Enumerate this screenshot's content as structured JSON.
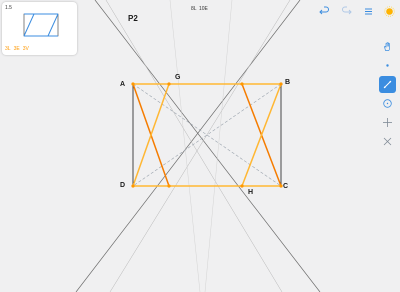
{
  "level": {
    "name": "P2",
    "number": "1.5"
  },
  "points": {
    "A": "A",
    "B": "B",
    "C": "C",
    "D": "D",
    "G": "G",
    "H": "H"
  },
  "header_stats": [
    "8L",
    "10E"
  ],
  "thumbnail": {
    "level_number": "1.5",
    "stats": [
      "3L",
      "3E",
      "3V"
    ]
  },
  "colors": {
    "accent": "#3b8de0",
    "figure": "#ff9800",
    "selected": "#f57c00",
    "given": "#222222",
    "hint": "#9aa3ad"
  },
  "toolbar": {
    "top": [
      {
        "name": "undo-icon",
        "interactable": true
      },
      {
        "name": "redo-icon",
        "interactable": true
      },
      {
        "name": "menu-icon",
        "interactable": true
      },
      {
        "name": "hint-icon",
        "interactable": true
      }
    ],
    "side": [
      {
        "name": "hand-icon",
        "active": false
      },
      {
        "name": "point-icon",
        "active": false
      },
      {
        "name": "line-icon",
        "active": true
      },
      {
        "name": "circle-icon",
        "active": false
      },
      {
        "name": "perpendicular-icon",
        "active": false
      },
      {
        "name": "intersect-icon",
        "active": false
      }
    ]
  }
}
